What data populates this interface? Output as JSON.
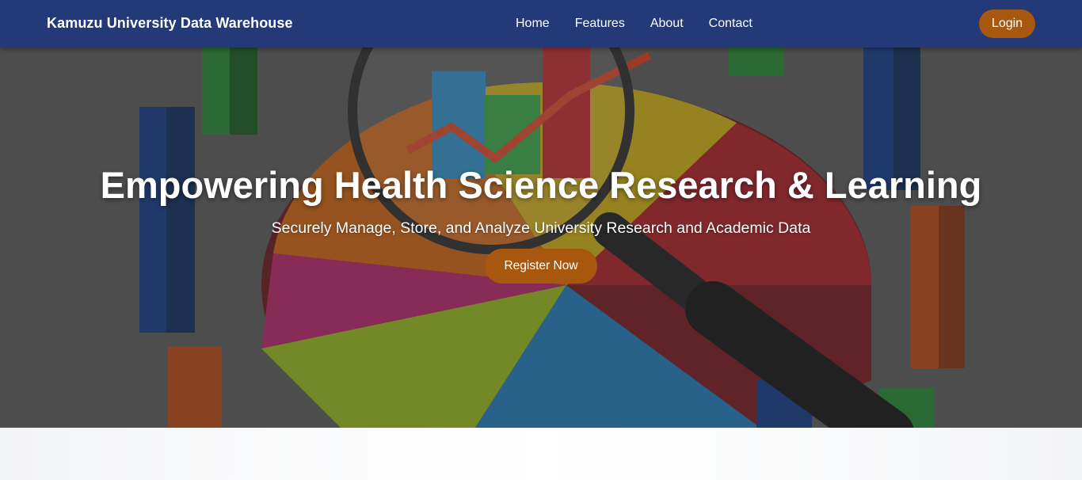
{
  "navbar": {
    "brand": "Kamuzu University Data Warehouse",
    "links": [
      "Home",
      "Features",
      "About",
      "Contact"
    ],
    "login_label": "Login"
  },
  "hero": {
    "title": "Empowering Health Science Research & Learning",
    "subtitle": "Securely Manage, Store, and Analyze University Research and Academic Data",
    "cta_label": "Register Now",
    "background_image": "3d-pie-chart-bar-chart-magnifying-glass"
  },
  "colors": {
    "navbar": "#243a78",
    "accent": "#a8580e",
    "text_light": "#ffffff",
    "page_bg": "#f5f6f8"
  }
}
